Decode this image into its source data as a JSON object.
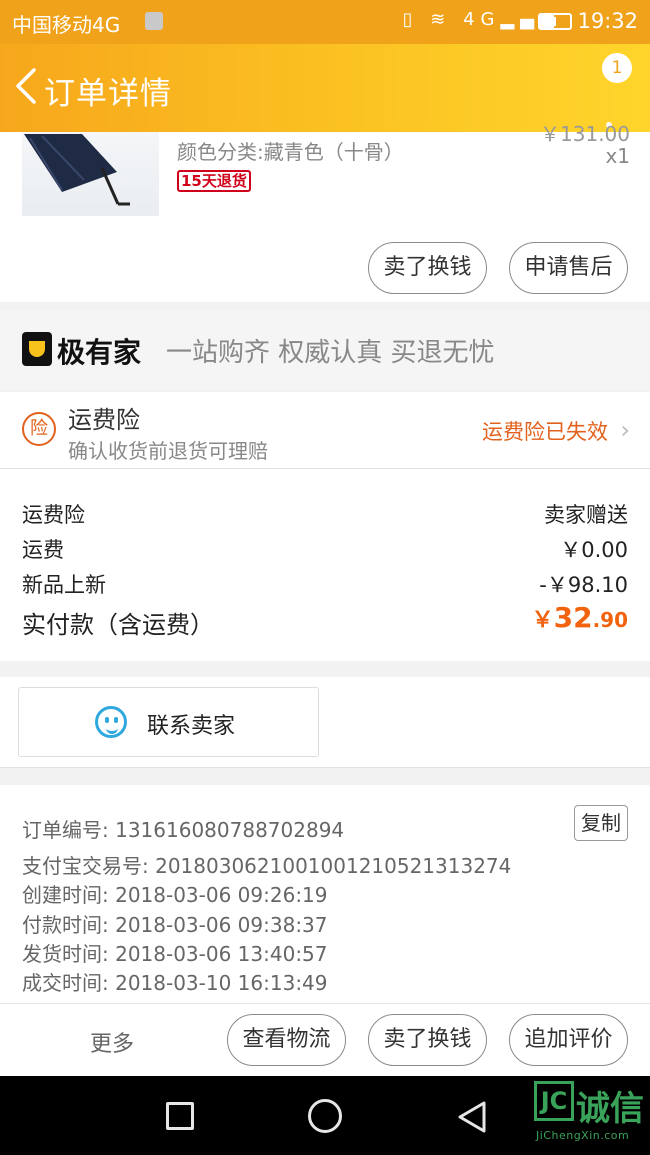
{
  "status_bar": {
    "carrier": "中国移动4G",
    "network": "4G",
    "time": "19:32"
  },
  "header": {
    "title": "订单详情",
    "badge": "1"
  },
  "product": {
    "price": "￥131.00",
    "variant": "颜色分类:藏青色（十骨）",
    "quantity": "x1",
    "tag": "15天退货",
    "buttons": {
      "sell": "卖了换钱",
      "after_sale": "申请售后"
    }
  },
  "brand_banner": {
    "name": "极有家",
    "slogan": "一站购齐 权威认真 买退无忧"
  },
  "insurance": {
    "icon_text": "险",
    "title": "运费险",
    "subtitle": "确认收货前退货可理赔",
    "status": "运费险已失效"
  },
  "fees": {
    "rows": [
      {
        "label": "运费险",
        "value": "卖家赠送"
      },
      {
        "label": "运费",
        "value": "￥0.00"
      },
      {
        "label": "新品上新",
        "value": "-￥98.10"
      }
    ],
    "total": {
      "label": "实付款（含运费）",
      "currency": "￥",
      "integer": "32",
      "decimal": ".90"
    }
  },
  "contact": {
    "label": "联系卖家"
  },
  "order_info": {
    "copy_label": "复制",
    "lines": [
      "订单编号: 131616080788702894",
      "支付宝交易号: 2018030621001001210521313274",
      "创建时间: 2018-03-06 09:26:19",
      "付款时间: 2018-03-06 09:38:37",
      "发货时间: 2018-03-06 13:40:57",
      "成交时间: 2018-03-10 16:13:49"
    ]
  },
  "actions": {
    "more": "更多",
    "logistics": "查看物流",
    "sell": "卖了换钱",
    "review": "追加评价"
  },
  "watermark": {
    "mark": "JC",
    "name": "诚信",
    "url": "JiChengXin.com"
  },
  "colors": {
    "header": "#f7a71c",
    "accent": "#f2630f",
    "link_blue": "#2fa8e0"
  }
}
